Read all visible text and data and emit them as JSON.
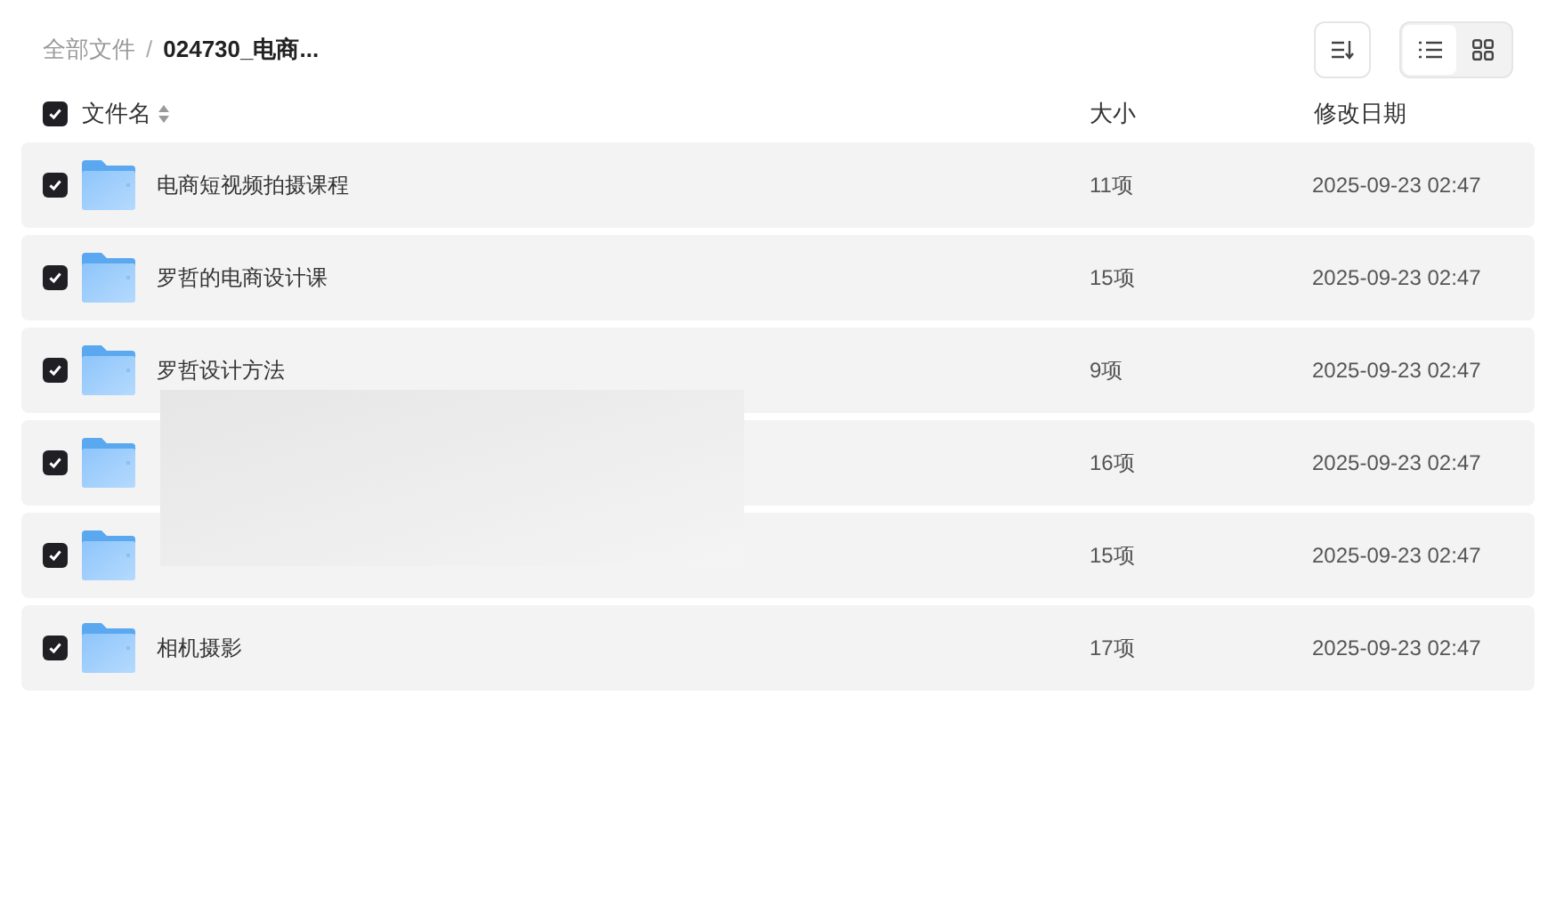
{
  "breadcrumb_separator": "/",
  "breadcrumb": [
    {
      "label": "全部文件",
      "current": false
    },
    {
      "label": "024730_电商...",
      "current": true
    }
  ],
  "view_modes": [
    {
      "kind": "list",
      "selected": true
    },
    {
      "kind": "grid",
      "selected": false
    }
  ],
  "header": {
    "checked": true,
    "columns": [
      "文件名",
      "大小",
      "修改日期"
    ]
  },
  "rows": [
    {
      "checked": true,
      "name": "电商短视频拍摄课程",
      "size": "11项",
      "date": "2025-09-23 02:47"
    },
    {
      "checked": true,
      "name": "罗哲的电商设计课",
      "size": "15项",
      "date": "2025-09-23 02:47"
    },
    {
      "checked": true,
      "name": "罗哲设计方法",
      "size": "9项",
      "date": "2025-09-23 02:47"
    },
    {
      "checked": true,
      "size": "16项",
      "date": "2025-09-23 02:47"
    },
    {
      "checked": true,
      "size": "15项",
      "date": "2025-09-23 02:47"
    },
    {
      "checked": true,
      "name": "相机摄影",
      "size": "17项",
      "date": "2025-09-23 02:47"
    }
  ]
}
